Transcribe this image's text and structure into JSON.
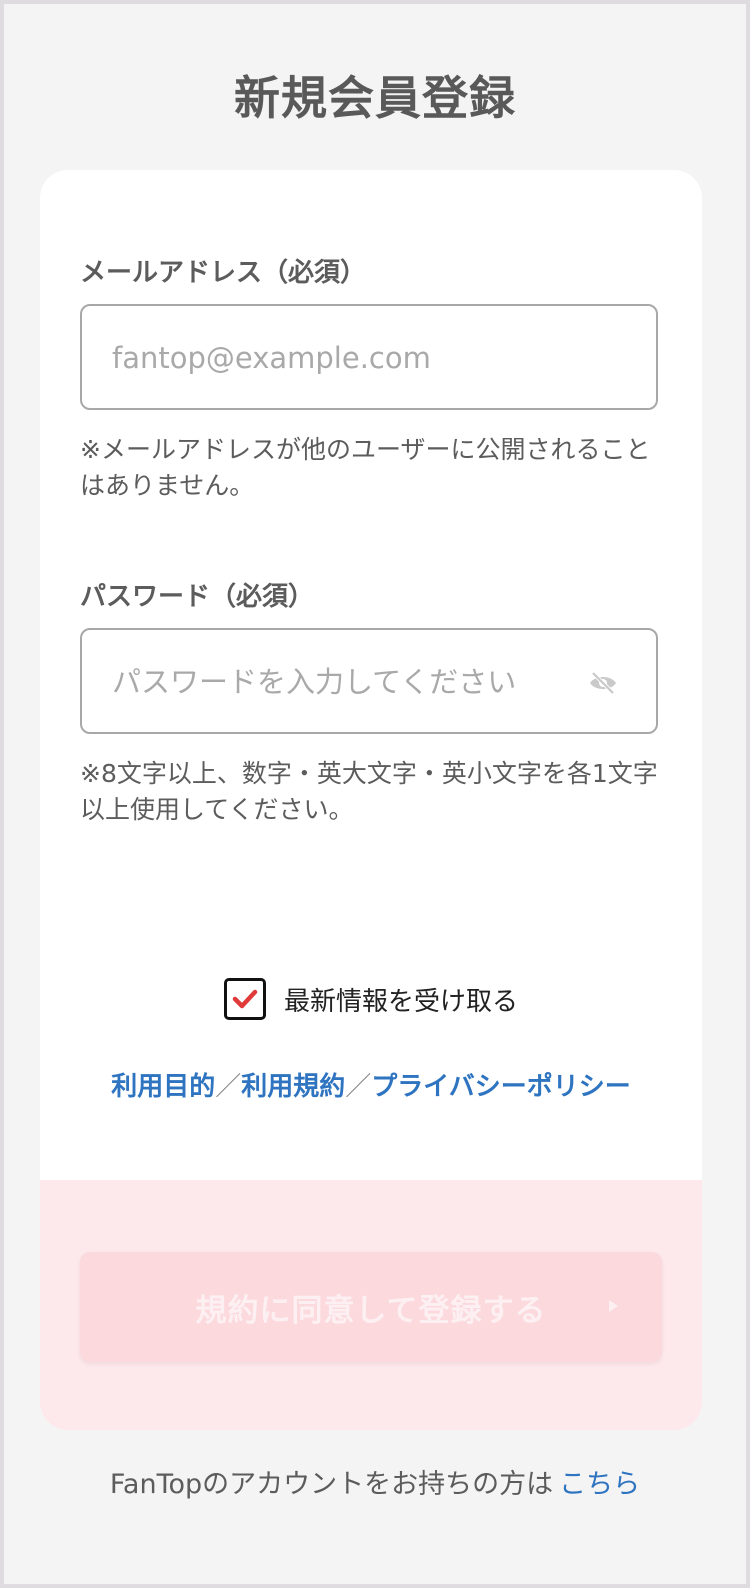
{
  "header": {
    "title": "新規会員登録"
  },
  "email": {
    "label": "メールアドレス（必須）",
    "placeholder": "fantop@example.com",
    "value": "",
    "note": "※メールアドレスが他のユーザーに公開されることはありません。"
  },
  "password": {
    "label": "パスワード（必須）",
    "placeholder": "パスワードを入力してください",
    "value": "",
    "note": "※8文字以上、数字・英大文字・英小文字を各1文字以上使用してください。",
    "toggle_icon": "eye-off-icon"
  },
  "newsletter": {
    "label": "最新情報を受け取る",
    "checked": true,
    "check_color": "#e03a3a"
  },
  "links": {
    "purpose": "利用目的",
    "terms": "利用規約",
    "privacy": "プライバシーポリシー",
    "separator": "／"
  },
  "submit": {
    "label": "規約に同意して登録する"
  },
  "footer": {
    "text": "FanTopのアカウントをお持ちの方は",
    "link": "こちら"
  },
  "colors": {
    "accent_link": "#2e74c0",
    "band": "#fde8eb",
    "button_disabled": "#fbd9dd"
  }
}
